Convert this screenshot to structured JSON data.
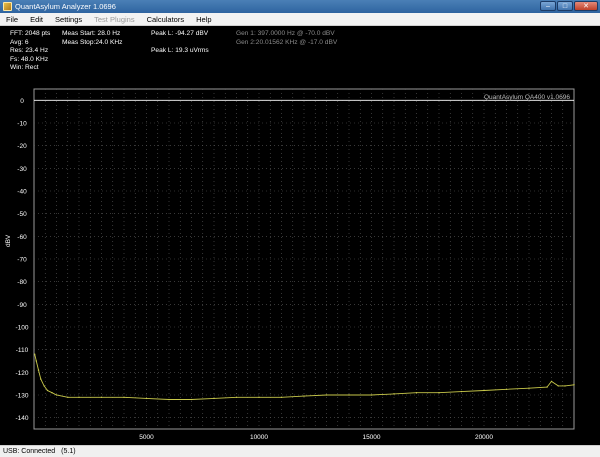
{
  "window": {
    "title": "QuantAsylum Analyzer 1.0696",
    "minimize": "–",
    "maximize": "□",
    "close": "✕"
  },
  "menu": [
    {
      "label": "File",
      "enabled": true
    },
    {
      "label": "Edit",
      "enabled": true
    },
    {
      "label": "Settings",
      "enabled": true
    },
    {
      "label": "Test Plugins",
      "enabled": false
    },
    {
      "label": "Calculators",
      "enabled": true
    },
    {
      "label": "Help",
      "enabled": true
    }
  ],
  "info": {
    "col1": [
      "FFT: 2048 pts",
      "Avg: 6",
      "Res: 23.4 Hz",
      "Fs: 48.0 KHz",
      "Win: Rect"
    ],
    "col2": [
      "Meas Start: 28.0 Hz",
      "Meas Stop:24.0 KHz"
    ],
    "col3": [
      "Peak L: -94.27 dBV",
      "",
      "Peak L: 19.3 uVrms"
    ],
    "col4": [
      "Gen 1: 397.0000 Hz @ -70.0  dBV",
      "Gen 2:20.01562 KHz @ -17.0  dBV"
    ]
  },
  "status": {
    "connection": "USB: Connected",
    "version": "(5.1)"
  },
  "chart_data": {
    "type": "line",
    "watermark": "QuantAsylum QA400 v1.0696",
    "ylabel": "dBV",
    "xlabel": "",
    "xlim": [
      0,
      24000
    ],
    "ylim": [
      -145,
      5
    ],
    "yticks": [
      0,
      -10,
      -20,
      -30,
      -40,
      -50,
      -60,
      -70,
      -80,
      -90,
      -100,
      -110,
      -120,
      -130,
      -140
    ],
    "xticks": [
      5000,
      10000,
      15000,
      20000
    ],
    "grid": true,
    "colors": {
      "trace": "#c8c84a",
      "grid": "#5a5a5a",
      "reference": "#ffffff"
    },
    "reference_line": 0,
    "series": [
      {
        "x": [
          30,
          100,
          200,
          300,
          450,
          600,
          800,
          1000,
          1500,
          2000,
          3000,
          4000,
          5000,
          6000,
          7000,
          8000,
          9000,
          10000,
          11000,
          12000,
          13000,
          14000,
          15000,
          16000,
          17000,
          18000,
          19000,
          20000,
          21000,
          22000,
          22800,
          23000,
          23300,
          23600,
          24000
        ],
        "y": [
          -112,
          -115,
          -119,
          -123,
          -126,
          -128,
          -129,
          -130,
          -131,
          -131,
          -131,
          -131,
          -131.5,
          -132,
          -132,
          -131.5,
          -131,
          -131,
          -131,
          -130.5,
          -130,
          -130,
          -130,
          -129.5,
          -129,
          -129,
          -128.5,
          -128,
          -127.5,
          -127,
          -126.5,
          -124,
          -126,
          -126,
          -125.5
        ]
      }
    ]
  }
}
